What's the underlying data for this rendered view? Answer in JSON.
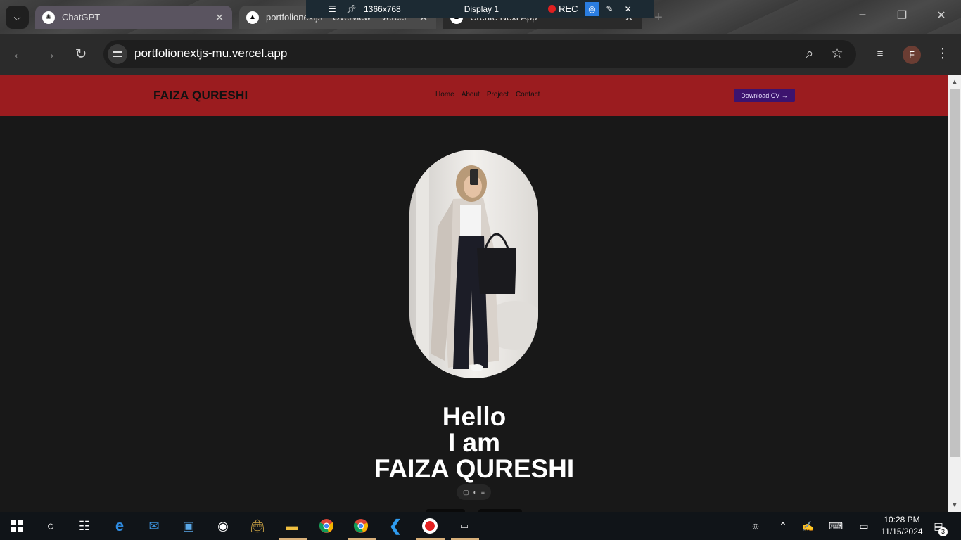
{
  "browser": {
    "tabs": [
      {
        "title": "ChatGPT",
        "favicon": "chatgpt-icon"
      },
      {
        "title": "portfolionextjs – Overview – Vercel",
        "favicon": "vercel-icon"
      },
      {
        "title": "Create Next App",
        "favicon": "vercel-icon"
      }
    ],
    "url": "portfolionextjs-mu.vercel.app",
    "profile_initial": "F"
  },
  "recorder": {
    "resolution": "1366x768",
    "display": "Display 1",
    "rec_label": "REC"
  },
  "site": {
    "brand": "FAIZA QURESHI",
    "nav": [
      "Home",
      "About",
      "Project",
      "Contact"
    ],
    "cta": "Download CV",
    "cta_arrow": "→",
    "hero": {
      "line1": "Hello",
      "line2": "I am",
      "line3": "FAIZA QURESHI"
    },
    "colors": {
      "header": "#9b1c1f",
      "cta": "#3c136e",
      "background": "#181818"
    }
  },
  "taskbar": {
    "time": "10:28 PM",
    "date": "11/15/2024",
    "notifications": "3"
  }
}
